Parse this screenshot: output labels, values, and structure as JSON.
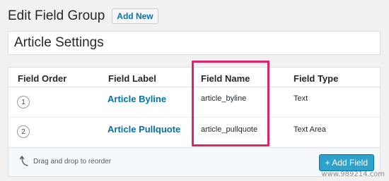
{
  "header": {
    "title": "Edit Field Group",
    "add_new_label": "Add New"
  },
  "group_title": {
    "value": "Article Settings"
  },
  "table": {
    "columns": [
      "Field Order",
      "Field Label",
      "Field Name",
      "Field Type"
    ],
    "rows": [
      {
        "order": "1",
        "label": "Article Byline",
        "name": "article_byline",
        "type": "Text"
      },
      {
        "order": "2",
        "label": "Article Pullquote",
        "name": "article_pullquote",
        "type": "Text Area"
      }
    ]
  },
  "footer": {
    "hint": "Drag and drop to reorder",
    "add_field_label": "+ Add Field"
  },
  "watermark": "www.989214.com",
  "colors": {
    "highlight": "#e0246b",
    "link": "#0073aa",
    "primary_button": "#2ea2cc"
  },
  "icons": {
    "drag": "curved-arrow-up-icon"
  }
}
